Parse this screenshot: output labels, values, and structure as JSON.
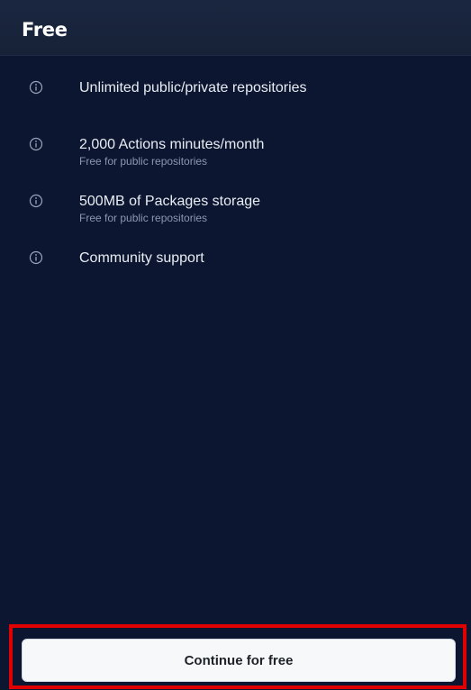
{
  "plan": {
    "title": "Free"
  },
  "features": [
    {
      "label": "Unlimited public/private repositories",
      "icon": "info-icon"
    },
    {
      "label": "2,000 Actions minutes/month",
      "note": "Free for public repositories",
      "icon": "info-icon"
    },
    {
      "label": "500MB of Packages storage",
      "note": "Free for public repositories",
      "icon": "info-icon"
    },
    {
      "label": "Community support",
      "icon": "info-icon"
    }
  ],
  "cta": {
    "label": "Continue for free"
  },
  "colors": {
    "background": "#0d1630",
    "header": "#1a2640",
    "text": "#e6edf3",
    "muted": "#8b97b1",
    "button": "#f6f8fa",
    "highlight": "#e00000"
  }
}
